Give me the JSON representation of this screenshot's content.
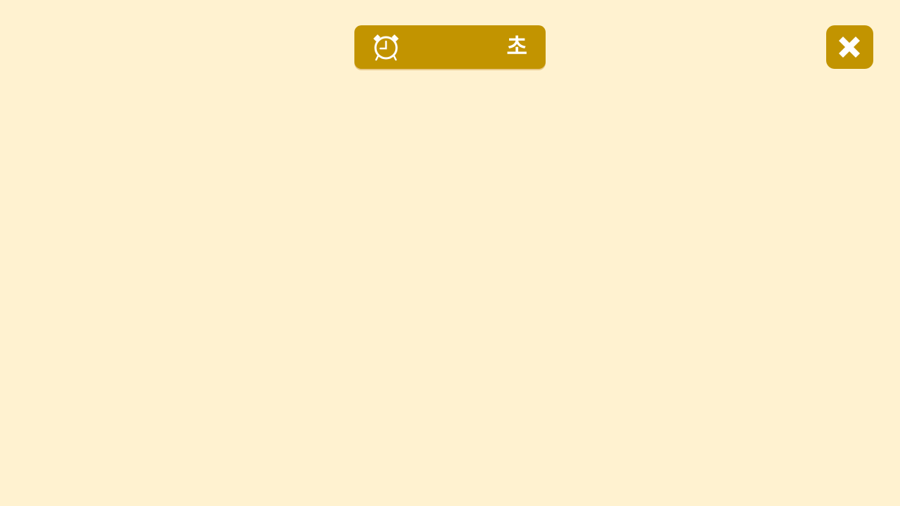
{
  "colors": {
    "background": "#FFF2D0",
    "accent": "#C29400",
    "icon": "#FFFFFF"
  },
  "timer": {
    "icon": "alarm-clock-icon",
    "value": "",
    "unit": "초"
  },
  "close_button": {
    "icon": "close-icon"
  }
}
